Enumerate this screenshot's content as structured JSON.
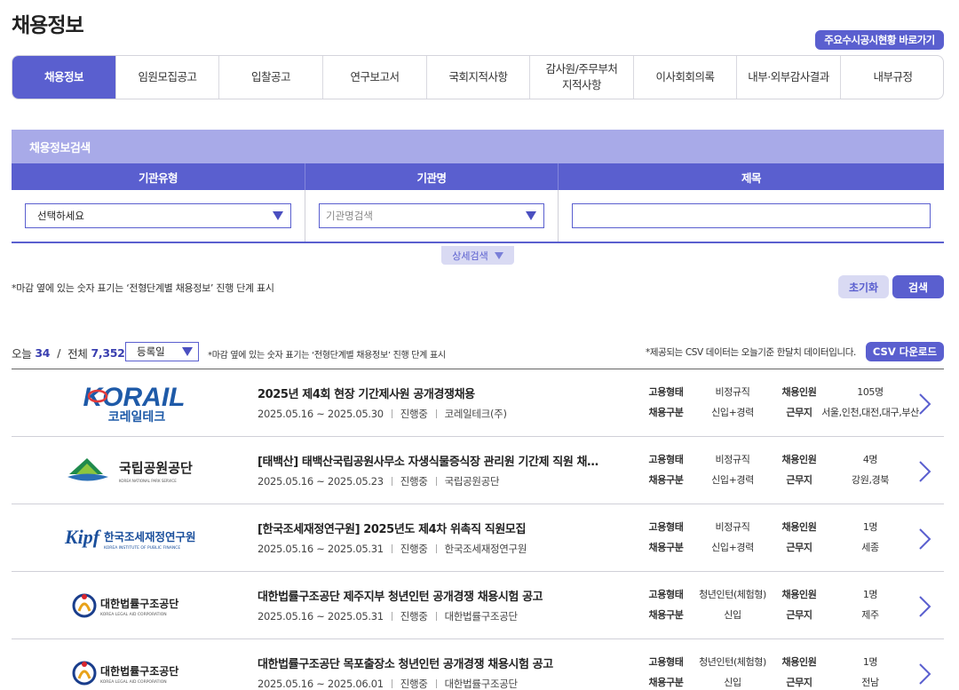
{
  "page": {
    "title": "채용정보",
    "shortcut_label": "주요수시공시현황 바로가기"
  },
  "tabs": [
    {
      "label": "채용정보",
      "active": true
    },
    {
      "label": "임원모집공고",
      "active": false
    },
    {
      "label": "입찰공고",
      "active": false
    },
    {
      "label": "연구보고서",
      "active": false
    },
    {
      "label": "국회지적사항",
      "active": false
    },
    {
      "label": "감사원/주무부처\n지적사항",
      "active": false
    },
    {
      "label": "이사회회의록",
      "active": false
    },
    {
      "label": "내부·외부감사결과",
      "active": false
    },
    {
      "label": "내부규정",
      "active": false
    }
  ],
  "search": {
    "header": "채용정보검색",
    "col_org_type": "기관유형",
    "col_org_name": "기관명",
    "col_title": "제목",
    "org_type_value": "선택하세요",
    "org_name_placeholder": "기관명검색",
    "title_value": "",
    "detail_label": "상세검색",
    "note": "*마감 옆에 있는 숫자 표기는 ‘전형단계별 채용정보’ 진행 단계 표시",
    "reset_label": "초기화",
    "search_label": "검색"
  },
  "list_header": {
    "today_label": "오늘",
    "today_count": "34",
    "slash": "/",
    "total_label": "전체",
    "total_count": "7,352",
    "sort_value": "등록일",
    "note": "*마감 옆에 있는 숫자 표기는 ‘전형단계별 채용정보’ 진행 단계 표시",
    "csv_note": "*제공되는 CSV 데이터는 오늘기준 한달치 데이터입니다.",
    "csv_label": "CSV 다운로드"
  },
  "info_labels": {
    "emp_type": "고용형태",
    "headcount": "채용인원",
    "category": "채용구분",
    "location": "근무지"
  },
  "postings": [
    {
      "logo": "korail",
      "logo_text": "KORAIL",
      "logo_sub": "코레일테크",
      "title": "2025년 제4회 현장 기간제사원 공개경쟁채용",
      "period": "2025.05.16 ~ 2025.05.30",
      "status": "진행중",
      "org": "코레일테크(주)",
      "emp_type": "비정규직",
      "headcount": "105명",
      "category": "신입+경력",
      "location": "서울,인천,대전,대구,부산"
    },
    {
      "logo": "knps",
      "logo_text": "국립공원공단",
      "logo_sub": "KOREA NATIONAL PARK SERVICE",
      "title": "[태백산] 태백산국립공원사무소 자생식물증식장 관리원 기간제 직원 채…",
      "period": "2025.05.16 ~ 2025.05.23",
      "status": "진행중",
      "org": "국립공원공단",
      "emp_type": "비정규직",
      "headcount": "4명",
      "category": "신입+경력",
      "location": "강원,경북"
    },
    {
      "logo": "kipf",
      "logo_text": "한국조세재정연구원",
      "logo_sub": "KOREA INSTITUTE OF PUBLIC FINANCE",
      "title": "[한국조세재정연구원] 2025년도 제4차 위촉직 직원모집",
      "period": "2025.05.16 ~ 2025.05.31",
      "status": "진행중",
      "org": "한국조세재정연구원",
      "emp_type": "비정규직",
      "headcount": "1명",
      "category": "신입+경력",
      "location": "세종"
    },
    {
      "logo": "klac",
      "logo_text": "대한법률구조공단",
      "logo_sub": "KOREA LEGAL AID CORPORATION",
      "title": "대한법률구조공단 제주지부 청년인턴 공개경쟁 채용시험 공고",
      "period": "2025.05.16 ~ 2025.05.31",
      "status": "진행중",
      "org": "대한법률구조공단",
      "emp_type": "청년인턴(체험형)",
      "headcount": "1명",
      "category": "신입",
      "location": "제주"
    },
    {
      "logo": "klac",
      "logo_text": "대한법률구조공단",
      "logo_sub": "KOREA LEGAL AID CORPORATION",
      "title": "대한법률구조공단 목포출장소 청년인턴 공개경쟁 채용시험 공고",
      "period": "2025.05.16 ~ 2025.06.01",
      "status": "진행중",
      "org": "대한법률구조공단",
      "emp_type": "청년인턴(체험형)",
      "headcount": "1명",
      "category": "신입",
      "location": "전남"
    }
  ],
  "colors": {
    "accent": "#5a5fcf",
    "accent_light": "#a8aae8",
    "korail_blue": "#1e5aa8"
  }
}
